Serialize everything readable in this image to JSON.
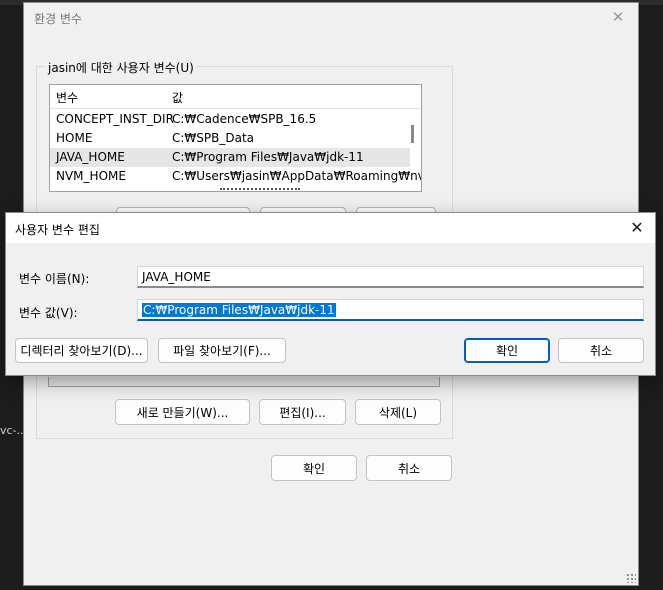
{
  "background": {
    "text": "vc-..."
  },
  "env_window": {
    "title": "환경 변수",
    "group_label": "jasin에 대한 사용자 변수(U)",
    "columns": [
      "변수",
      "값"
    ],
    "rows": [
      {
        "name": "CONCEPT_INST_DIR",
        "value": "C:₩Cadence₩SPB_16.5"
      },
      {
        "name": "HOME",
        "value": "C:₩SPB_Data"
      },
      {
        "name": "JAVA_HOME",
        "value": "C:₩Program Files₩Java₩jdk-11"
      },
      {
        "name": "NVM_HOME",
        "value": "C:₩Users₩jasin₩AppData₩Roaming₩nvm"
      }
    ],
    "new_button": "새로 만들기(W)...",
    "edit_button": "편집(I)...",
    "delete_button": "삭제(L)",
    "ok_button": "확인",
    "cancel_button": "취소"
  },
  "edit_dialog": {
    "title": "사용자 변수 편집",
    "name_label": "변수 이름(N):",
    "name_value": "JAVA_HOME",
    "value_label": "변수 값(V):",
    "value_value": "C:₩Program Files₩Java₩jdk-11",
    "browse_dir_button": "디렉터리 찾아보기(D)...",
    "browse_file_button": "파일 찾아보기(F)...",
    "ok_button": "확인",
    "cancel_button": "취소"
  },
  "icons": {
    "close": "close-icon"
  },
  "colors": {
    "accent": "#005fb8",
    "selection": "#0078d7"
  }
}
